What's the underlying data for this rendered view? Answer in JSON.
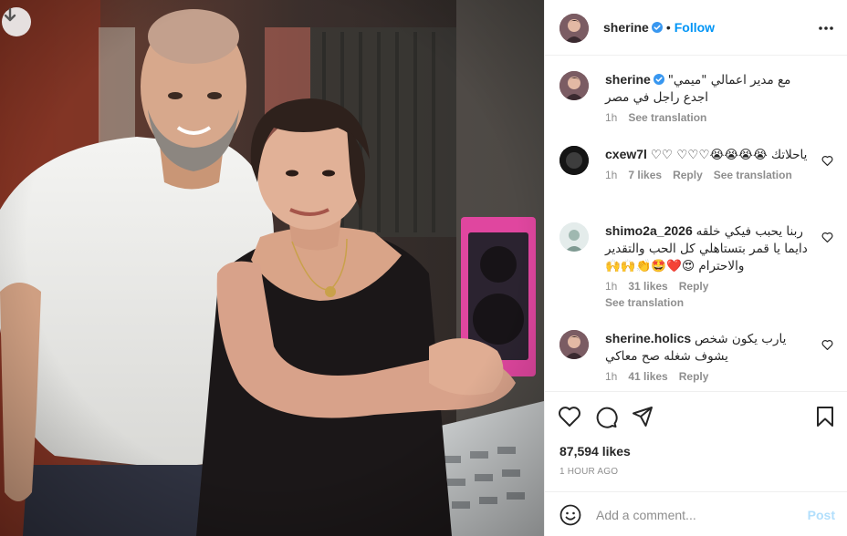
{
  "post": {
    "author": "sherine",
    "follow_label": "Follow",
    "separator": "•",
    "caption": {
      "username": "sherine",
      "text": "مع مدير اعمالي \"ميمي\" اجدع راجل في مصر",
      "time": "1h",
      "see_translation": "See translation"
    },
    "comments": [
      {
        "username": "cxew7l",
        "text": "ياحلاتك 😭😭😭😭♡♡♡ ♡♡",
        "time": "1h",
        "likes": "7 likes",
        "reply": "Reply",
        "see_translation": "See translation"
      },
      {
        "username": "shimo2a_2026",
        "text": "ربنا يحبب فيكي خلقه دايما يا قمر بتستاهلي كل الحب والتقدير والاحترام 😍❤️🤩👏🙌🙌",
        "time": "1h",
        "likes": "31 likes",
        "reply": "Reply",
        "see_translation": "See translation"
      },
      {
        "username": "sherine.holics",
        "text": "يارب يكون شخص يشوف شغله صح معاكي",
        "time": "1h",
        "likes": "41 likes",
        "reply": "Reply"
      }
    ],
    "likes_count": "87,594 likes",
    "time_ago": "1 HOUR AGO",
    "add_comment_placeholder": "Add a comment...",
    "post_label": "Post"
  },
  "icons": {
    "download": "download-icon",
    "verified": "verified-badge-icon",
    "more": "more-options-icon",
    "heart": "heart-icon",
    "comment": "comment-icon",
    "share": "share-icon",
    "save": "bookmark-icon",
    "emoji": "emoji-icon"
  },
  "colors": {
    "accent": "#0095f6",
    "post_disabled": "#b2dffc",
    "verified": "#3897f0",
    "muted": "#8e8e8e"
  }
}
